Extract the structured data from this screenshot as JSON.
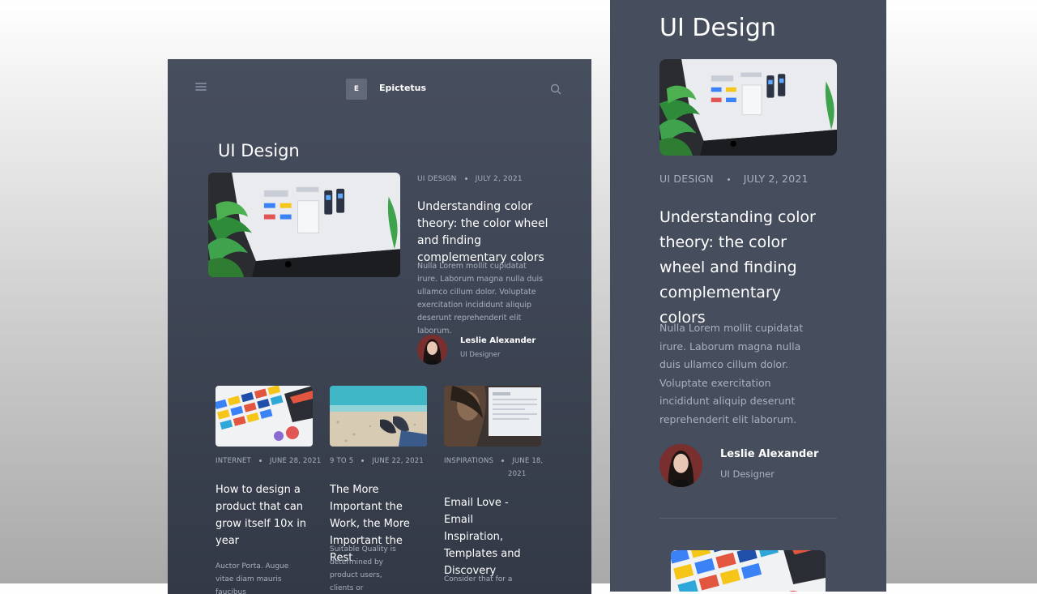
{
  "desktop": {
    "brand": {
      "logo_letter": "E",
      "name": "Epictetus"
    },
    "icons": {
      "menu": "hamburger-menu-icon",
      "search": "search-icon"
    },
    "heading": "UI Design",
    "featured": {
      "image": "imac-ui-kit-with-plant-photo",
      "category": "UI DESIGN",
      "date": "JULY 2, 2021",
      "title": "Understanding color theory: the color wheel and finding complementary colors",
      "excerpt": "Nulla Lorem mollit cupidatat irure. Laborum magna nulla duis ullamco cillum dolor. Voluptate exercitation incididunt aliquip deserunt reprehenderit elit laborum.",
      "author": {
        "name": "Leslie Alexander",
        "role": "UI Designer"
      }
    },
    "cards": [
      {
        "image": "color-swatches-photo",
        "category": "INTERNET",
        "date": "JUNE 28, 2021",
        "title": "How to design a product that can grow itself 10x in year",
        "excerpt": "Auctor Porta. Augue vitae diam mauris faucibus"
      },
      {
        "image": "beach-feet-photo",
        "category": "9 TO 5",
        "date": "JUNE 22, 2021",
        "title": "The More Important the Work, the More Important the Rest",
        "excerpt": "Suitable Quality is determined by product users, clients or"
      },
      {
        "image": "person-at-laptop-photo",
        "category": "INSPIRATIONS",
        "date_line1": "JUNE 18,",
        "date_line2": "2021",
        "title": "Email Love - Email Inspiration, Templates and Discovery",
        "excerpt": "Consider that for a"
      }
    ]
  },
  "mobile": {
    "heading": "UI Design",
    "featured": {
      "image": "imac-ui-kit-with-plant-photo",
      "category": "UI DESIGN",
      "date": "JULY 2, 2021",
      "title": "Understanding color theory: the color wheel and finding complementary colors",
      "excerpt": "Nulla Lorem mollit cupidatat irure. Laborum magna nulla duis ullamco cillum dolor. Voluptate exercitation incididunt aliquip deserunt reprehenderit elit laborum.",
      "author": {
        "name": "Leslie Alexander",
        "role": "UI Designer"
      }
    },
    "next_image": "color-swatches-photo"
  },
  "colors": {
    "panel": "#464d5c",
    "text": "#ffffff",
    "muted": "#aab0bd",
    "logo_bg": "#626a7a"
  }
}
